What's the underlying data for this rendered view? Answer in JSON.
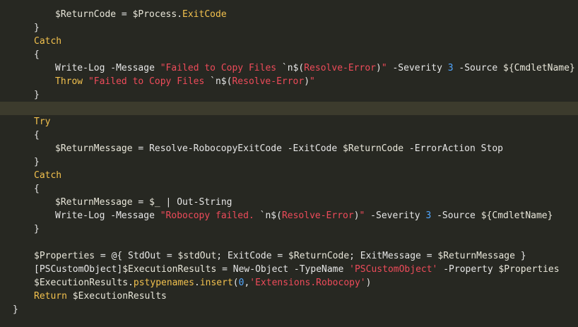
{
  "editor": {
    "background": "#272822",
    "current_line_color": "#3c3b2d",
    "token_colors": {
      "keyword": "#f2c14e",
      "string": "#ee4b5a",
      "number": "#51a7ff",
      "text": "#e6e6e6"
    }
  },
  "lines": [
    {
      "indent": 2,
      "tokens": [
        {
          "t": "$ReturnCode",
          "c": "var"
        },
        {
          "t": " = ",
          "c": "op"
        },
        {
          "t": "$Process",
          "c": "var"
        },
        {
          "t": ".",
          "c": "punct"
        },
        {
          "t": "ExitCode",
          "c": "prop"
        }
      ]
    },
    {
      "indent": 1,
      "tokens": [
        {
          "t": "}",
          "c": "punct"
        }
      ]
    },
    {
      "indent": 1,
      "tokens": [
        {
          "t": "Catch",
          "c": "kw"
        }
      ]
    },
    {
      "indent": 1,
      "tokens": [
        {
          "t": "{",
          "c": "punct"
        }
      ]
    },
    {
      "indent": 2,
      "tokens": [
        {
          "t": "Write-Log",
          "c": "cmd"
        },
        {
          "t": " -Message ",
          "c": "param"
        },
        {
          "t": "\"Failed to Copy Files ",
          "c": "str"
        },
        {
          "t": "`n$(",
          "c": "esc"
        },
        {
          "t": "Resolve-Error",
          "c": "str"
        },
        {
          "t": ")",
          "c": "esc"
        },
        {
          "t": "\"",
          "c": "str"
        },
        {
          "t": " -Severity ",
          "c": "param"
        },
        {
          "t": "3",
          "c": "num"
        },
        {
          "t": " -Source ",
          "c": "param"
        },
        {
          "t": "${CmdletName}",
          "c": "var"
        }
      ]
    },
    {
      "indent": 2,
      "tokens": [
        {
          "t": "Throw",
          "c": "kw"
        },
        {
          "t": " ",
          "c": "op"
        },
        {
          "t": "\"Failed to Copy Files ",
          "c": "str"
        },
        {
          "t": "`n$(",
          "c": "esc"
        },
        {
          "t": "Resolve-Error",
          "c": "str"
        },
        {
          "t": ")",
          "c": "esc"
        },
        {
          "t": "\"",
          "c": "str"
        }
      ]
    },
    {
      "indent": 1,
      "tokens": [
        {
          "t": "}",
          "c": "punct"
        }
      ]
    },
    {
      "indent": 0,
      "highlight": true,
      "tokens": []
    },
    {
      "indent": 1,
      "tokens": [
        {
          "t": "Try",
          "c": "kw"
        }
      ]
    },
    {
      "indent": 1,
      "tokens": [
        {
          "t": "{",
          "c": "punct"
        }
      ]
    },
    {
      "indent": 2,
      "tokens": [
        {
          "t": "$ReturnMessage",
          "c": "var"
        },
        {
          "t": " = ",
          "c": "op"
        },
        {
          "t": "Resolve-RobocopyExitCode",
          "c": "cmd"
        },
        {
          "t": " -ExitCode ",
          "c": "param"
        },
        {
          "t": "$ReturnCode",
          "c": "var"
        },
        {
          "t": " -ErrorAction Stop",
          "c": "param"
        }
      ]
    },
    {
      "indent": 1,
      "tokens": [
        {
          "t": "}",
          "c": "punct"
        }
      ]
    },
    {
      "indent": 1,
      "tokens": [
        {
          "t": "Catch",
          "c": "kw"
        }
      ]
    },
    {
      "indent": 1,
      "tokens": [
        {
          "t": "{",
          "c": "punct"
        }
      ]
    },
    {
      "indent": 2,
      "tokens": [
        {
          "t": "$ReturnMessage",
          "c": "var"
        },
        {
          "t": " = ",
          "c": "op"
        },
        {
          "t": "$_",
          "c": "var"
        },
        {
          "t": " | ",
          "c": "op"
        },
        {
          "t": "Out-String",
          "c": "cmd"
        }
      ]
    },
    {
      "indent": 2,
      "tokens": [
        {
          "t": "Write-Log",
          "c": "cmd"
        },
        {
          "t": " -Message ",
          "c": "param"
        },
        {
          "t": "\"Robocopy failed. ",
          "c": "str"
        },
        {
          "t": "`n$(",
          "c": "esc"
        },
        {
          "t": "Resolve-Error",
          "c": "str"
        },
        {
          "t": ")",
          "c": "esc"
        },
        {
          "t": "\"",
          "c": "str"
        },
        {
          "t": " -Severity ",
          "c": "param"
        },
        {
          "t": "3",
          "c": "num"
        },
        {
          "t": " -Source ",
          "c": "param"
        },
        {
          "t": "${CmdletName}",
          "c": "var"
        }
      ]
    },
    {
      "indent": 1,
      "tokens": [
        {
          "t": "}",
          "c": "punct"
        }
      ]
    },
    {
      "indent": 0,
      "tokens": []
    },
    {
      "indent": 1,
      "tokens": [
        {
          "t": "$Properties",
          "c": "var"
        },
        {
          "t": " = @{ StdOut = ",
          "c": "op"
        },
        {
          "t": "$stdOut",
          "c": "var"
        },
        {
          "t": "; ExitCode = ",
          "c": "op"
        },
        {
          "t": "$ReturnCode",
          "c": "var"
        },
        {
          "t": "; ExitMessage = ",
          "c": "op"
        },
        {
          "t": "$ReturnMessage",
          "c": "var"
        },
        {
          "t": " }",
          "c": "op"
        }
      ]
    },
    {
      "indent": 1,
      "tokens": [
        {
          "t": "[PSCustomObject]",
          "c": "type"
        },
        {
          "t": "$ExecutionResults",
          "c": "var"
        },
        {
          "t": " = ",
          "c": "op"
        },
        {
          "t": "New-Object",
          "c": "cmd"
        },
        {
          "t": " -TypeName ",
          "c": "param"
        },
        {
          "t": "'PSCustomObject'",
          "c": "str"
        },
        {
          "t": " -Property ",
          "c": "param"
        },
        {
          "t": "$Properties",
          "c": "var"
        }
      ]
    },
    {
      "indent": 1,
      "tokens": [
        {
          "t": "$ExecutionResults",
          "c": "var"
        },
        {
          "t": ".",
          "c": "punct"
        },
        {
          "t": "pstypenames",
          "c": "prop"
        },
        {
          "t": ".",
          "c": "punct"
        },
        {
          "t": "insert",
          "c": "prop"
        },
        {
          "t": "(",
          "c": "punct"
        },
        {
          "t": "0",
          "c": "num"
        },
        {
          "t": ",",
          "c": "punct"
        },
        {
          "t": "'Extensions.Robocopy'",
          "c": "str"
        },
        {
          "t": ")",
          "c": "punct"
        }
      ]
    },
    {
      "indent": 1,
      "tokens": [
        {
          "t": "Return",
          "c": "kw"
        },
        {
          "t": " ",
          "c": "op"
        },
        {
          "t": "$ExecutionResults",
          "c": "var"
        }
      ]
    },
    {
      "indent": 0,
      "tokens": [
        {
          "t": "}",
          "c": "punct"
        }
      ]
    }
  ]
}
